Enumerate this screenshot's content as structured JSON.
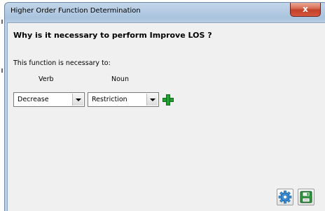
{
  "window": {
    "title": "Higher Order Function Determination",
    "close_label": "x"
  },
  "content": {
    "question": "Why is it necessary to perform Improve LOS ?",
    "necessary_label": "This function is necessary to:",
    "verb_header": "Verb",
    "noun_header": "Noun",
    "verb_value": "Decrease",
    "noun_value": "Restriction"
  },
  "icons": {
    "add": "plus-icon",
    "settings": "gear-icon",
    "save": "save-icon"
  },
  "colors": {
    "add_green": "#22a033",
    "settings_blue": "#3b8fd6",
    "save_green": "#2e9a3c"
  }
}
